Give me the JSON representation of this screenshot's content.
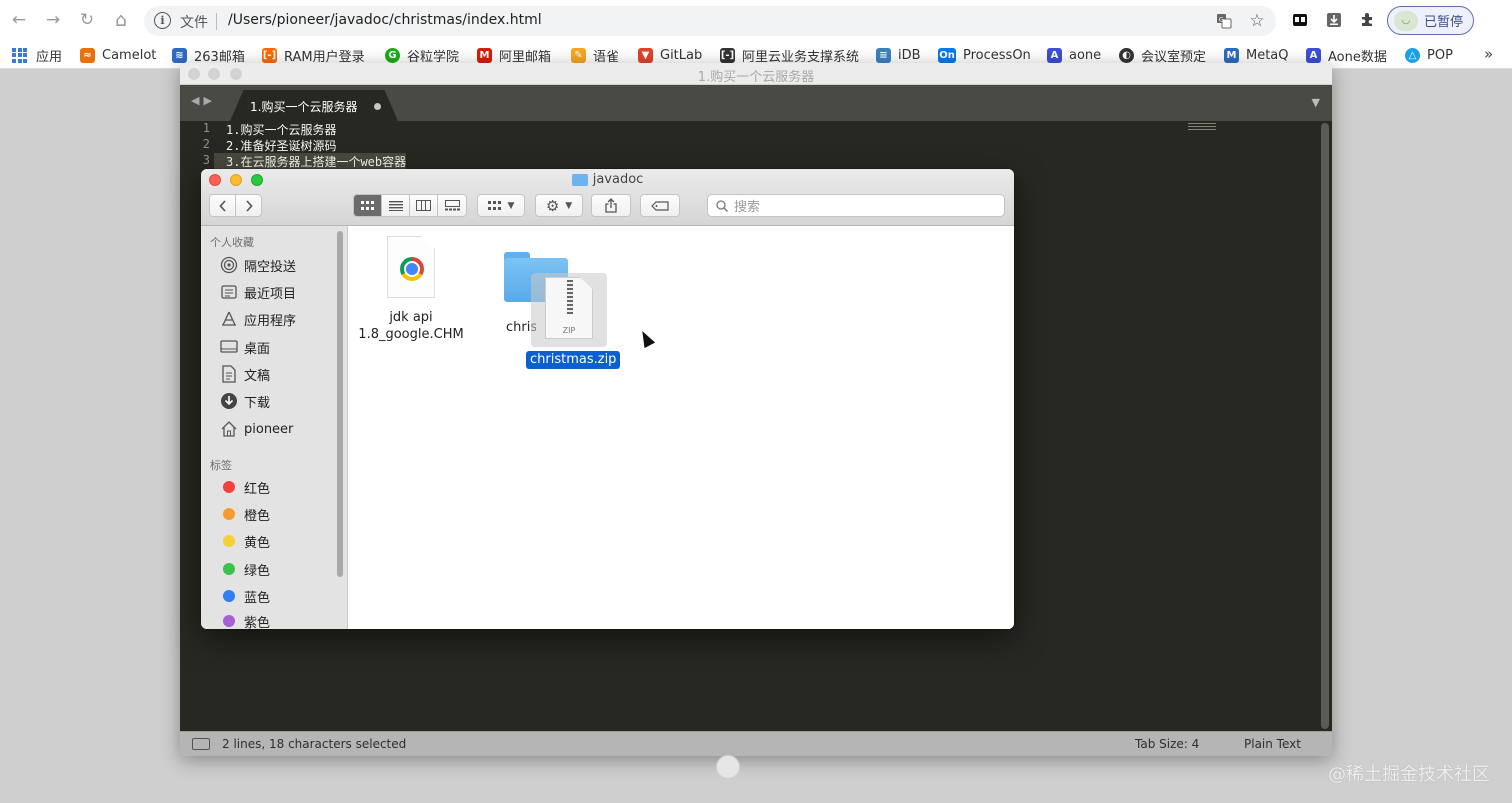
{
  "browser": {
    "nav": {
      "back": "←",
      "forward": "→",
      "reload": "↻",
      "home": "⌂"
    },
    "omnibox": {
      "scheme": "文件",
      "url": "/Users/pioneer/javadoc/christmas/index.html"
    },
    "profile": {
      "label": "已暂停"
    },
    "bookmarks": [
      {
        "label": "应用",
        "icon": "apps-grid-icon"
      },
      {
        "label": "Camelot",
        "icon": "camelot-icon",
        "color": "#e8710a"
      },
      {
        "label": "263邮箱",
        "icon": "mail-263-icon",
        "color": "#2b6cc4"
      },
      {
        "label": "RAM用户登录",
        "icon": "ram-icon",
        "color": "#ff6a00"
      },
      {
        "label": "谷粒学院",
        "icon": "guli-icon",
        "color": "#1aad19"
      },
      {
        "label": "阿里邮箱",
        "icon": "ali-mail-icon",
        "color": "#d81e06"
      },
      {
        "label": "语雀",
        "icon": "yuque-icon",
        "color": "#f5a623"
      },
      {
        "label": "GitLab",
        "icon": "gitlab-icon",
        "color": "#e24329"
      },
      {
        "label": "阿里云业务支撑系统",
        "icon": "aliyun-icon",
        "color": "#333333"
      },
      {
        "label": "iDB",
        "icon": "idb-icon",
        "color": "#3b82c4"
      },
      {
        "label": "ProcessOn",
        "icon": "processon-icon",
        "color": "#067bef"
      },
      {
        "label": "aone",
        "icon": "aone-icon",
        "color": "#3c4fd8"
      },
      {
        "label": "会议室预定",
        "icon": "meeting-icon",
        "color": "#333333"
      },
      {
        "label": "MetaQ",
        "icon": "metaq-icon",
        "color": "#2b6cc4"
      },
      {
        "label": "Aone数据",
        "icon": "aone-data-icon",
        "color": "#3c4fd8"
      },
      {
        "label": "POP",
        "icon": "pop-icon",
        "color": "#1aa0e8"
      }
    ],
    "bookmarks_more": "»"
  },
  "editor": {
    "title": "1.购买一个云服务器",
    "tab_label": "1.购买一个云服务器",
    "lines": [
      {
        "num": "1",
        "text": "1.购买一个云服务器"
      },
      {
        "num": "2",
        "text": "2.准备好圣诞树源码"
      },
      {
        "num": "3",
        "text": "3.在云服务器上搭建一个web容器"
      }
    ],
    "status": {
      "selection": "2 lines, 18 characters selected",
      "tab_size": "Tab Size: 4",
      "syntax": "Plain Text"
    }
  },
  "finder": {
    "title": "javadoc",
    "search_placeholder": "搜索",
    "sidebar": {
      "favorites_header": "个人收藏",
      "favorites": [
        {
          "label": "隔空投送",
          "icon": "airdrop-icon"
        },
        {
          "label": "最近项目",
          "icon": "recents-icon"
        },
        {
          "label": "应用程序",
          "icon": "applications-icon"
        },
        {
          "label": "桌面",
          "icon": "desktop-icon"
        },
        {
          "label": "文稿",
          "icon": "documents-icon"
        },
        {
          "label": "下载",
          "icon": "downloads-icon"
        },
        {
          "label": "pioneer",
          "icon": "home-icon"
        }
      ],
      "tags_header": "标签",
      "tags": [
        {
          "label": "红色",
          "color": "#f4413b"
        },
        {
          "label": "橙色",
          "color": "#f79a30"
        },
        {
          "label": "黄色",
          "color": "#f7d038"
        },
        {
          "label": "绿色",
          "color": "#3ec14b"
        },
        {
          "label": "蓝色",
          "color": "#2f7ff2"
        },
        {
          "label": "紫色",
          "color": "#a45fd3"
        }
      ]
    },
    "files": [
      {
        "name_line1": "jdk api",
        "name_line2": "1.8_google.CHM"
      },
      {
        "name": "christmas"
      },
      {
        "name": "christmas.zip",
        "badge": "ZIP"
      }
    ]
  },
  "watermark": "@稀土掘金技术社区"
}
